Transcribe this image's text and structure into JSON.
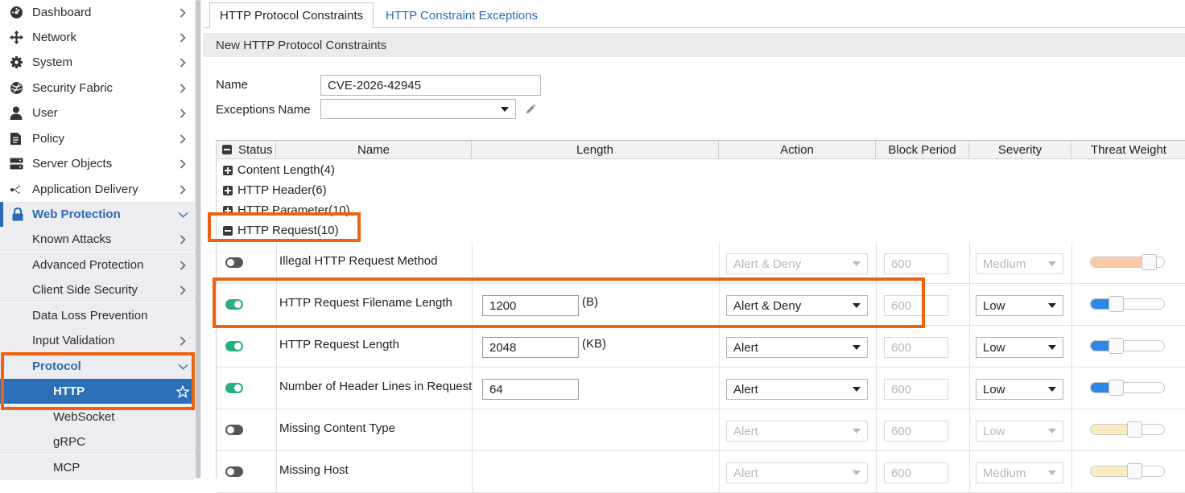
{
  "sidebar": {
    "items": [
      {
        "label": "Dashboard",
        "icon": "dashboard-icon"
      },
      {
        "label": "Network",
        "icon": "network-icon"
      },
      {
        "label": "System",
        "icon": "gear-icon"
      },
      {
        "label": "Security Fabric",
        "icon": "security-fabric-icon"
      },
      {
        "label": "User",
        "icon": "user-icon"
      },
      {
        "label": "Policy",
        "icon": "policy-icon"
      },
      {
        "label": "Server Objects",
        "icon": "server-icon"
      },
      {
        "label": "Application Delivery",
        "icon": "app-delivery-icon"
      },
      {
        "label": "Web Protection",
        "icon": "lock-icon"
      }
    ],
    "web_protection_children": [
      {
        "label": "Known Attacks"
      },
      {
        "label": "Advanced Protection"
      },
      {
        "label": "Client Side Security"
      },
      {
        "label": "Data Loss Prevention"
      },
      {
        "label": "Input Validation"
      },
      {
        "label": "Protocol"
      }
    ],
    "protocol_children": [
      {
        "label": "HTTP"
      },
      {
        "label": "WebSocket"
      },
      {
        "label": "gRPC"
      },
      {
        "label": "MCP"
      }
    ]
  },
  "tabs": [
    {
      "label": "HTTP Protocol Constraints"
    },
    {
      "label": "HTTP Constraint Exceptions"
    }
  ],
  "section_title": "New HTTP Protocol Constraints",
  "form": {
    "name_label": "Name",
    "name_value": "CVE-2026-42945",
    "exceptions_label": "Exceptions Name",
    "exceptions_value": ""
  },
  "table": {
    "columns": [
      "Status",
      "Name",
      "Length",
      "Action",
      "Block Period",
      "Severity",
      "Threat Weight"
    ],
    "groups": [
      {
        "label": "Content Length(4)",
        "expanded": false
      },
      {
        "label": "HTTP Header(6)",
        "expanded": false
      },
      {
        "label": "HTTP Parameter(10)",
        "expanded": false
      },
      {
        "label": "HTTP Request(10)",
        "expanded": true
      }
    ],
    "rows": [
      {
        "enabled": false,
        "name": "Illegal HTTP Request Method",
        "length": "",
        "unit": "",
        "action": "Alert & Deny",
        "block_period": "600",
        "severity": "Medium",
        "threat_weight": 0.8,
        "weight_color": "#fbc9a7"
      },
      {
        "enabled": true,
        "name": "HTTP Request Filename Length",
        "length": "1200",
        "unit": "(B)",
        "action": "Alert & Deny",
        "block_period": "600",
        "severity": "Low",
        "threat_weight": 0.35,
        "weight_color": "#2e86e8"
      },
      {
        "enabled": true,
        "name": "HTTP Request Length",
        "length": "2048",
        "unit": "(KB)",
        "action": "Alert",
        "block_period": "600",
        "severity": "Low",
        "threat_weight": 0.35,
        "weight_color": "#2e86e8"
      },
      {
        "enabled": true,
        "name": "Number of Header Lines in Request",
        "length": "64",
        "unit": "",
        "action": "Alert",
        "block_period": "600",
        "severity": "Low",
        "threat_weight": 0.35,
        "weight_color": "#2e86e8"
      },
      {
        "enabled": false,
        "name": "Missing Content Type",
        "length": "",
        "unit": "",
        "action": "Alert",
        "block_period": "600",
        "severity": "Low",
        "threat_weight": 0.6,
        "weight_color": "#fbecc0"
      },
      {
        "enabled": false,
        "name": "Missing Host",
        "length": "",
        "unit": "",
        "action": "Alert",
        "block_period": "600",
        "severity": "Medium",
        "threat_weight": 0.6,
        "weight_color": "#fbecc0"
      }
    ]
  },
  "colors": {
    "accent": "#2d6ab3",
    "selected_nav": "#2b6fb9",
    "highlight": "#f0620f",
    "toggle_on": "#27ae84"
  }
}
